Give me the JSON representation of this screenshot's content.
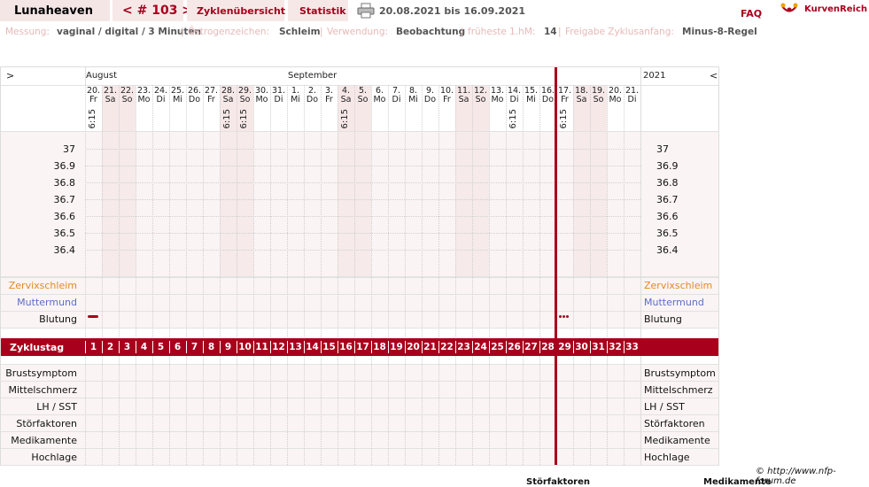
{
  "header": {
    "app_title": "Lunaheaven",
    "cycle_nav": "< # 103 >",
    "tabs": [
      {
        "label": "Zyklenübersicht"
      },
      {
        "label": "Statistik"
      }
    ],
    "date_range": "20.08.2021 bis 16.09.2021",
    "faq_label": "FAQ",
    "brand_label": "KurvenReich"
  },
  "info_bar": {
    "messung_label": "Messung:",
    "messung_value": "vaginal / digital / 3 Minuten",
    "oestrogen_label": "Östrogenzeichen:",
    "oestrogen_value": "Schleim",
    "verwendung_label": "Verwendung:",
    "verwendung_value": "Beobachtung",
    "hm_label": "früheste 1.hM:",
    "hm_value": "14",
    "freigabe_label": "Freigabe Zyklusanfang:",
    "freigabe_value": "Minus-8-Regel",
    "separator": "|"
  },
  "chart": {
    "left_arrow": ">",
    "right_arrow": "<",
    "months": [
      {
        "label": "August",
        "col": 0
      },
      {
        "label": "September",
        "col": 12
      }
    ],
    "year": "2021",
    "days": [
      {
        "d": "20.",
        "w": "Fr",
        "t": "6:15",
        "we": false
      },
      {
        "d": "21.",
        "w": "Sa",
        "t": "",
        "we": true
      },
      {
        "d": "22.",
        "w": "So",
        "t": "",
        "we": true
      },
      {
        "d": "23.",
        "w": "Mo",
        "t": "",
        "we": false
      },
      {
        "d": "24.",
        "w": "Di",
        "t": "",
        "we": false
      },
      {
        "d": "25.",
        "w": "Mi",
        "t": "",
        "we": false
      },
      {
        "d": "26.",
        "w": "Do",
        "t": "",
        "we": false
      },
      {
        "d": "27.",
        "w": "Fr",
        "t": "",
        "we": false
      },
      {
        "d": "28.",
        "w": "Sa",
        "t": "6:15",
        "we": true
      },
      {
        "d": "29.",
        "w": "So",
        "t": "6:15",
        "we": true
      },
      {
        "d": "30.",
        "w": "Mo",
        "t": "",
        "we": false
      },
      {
        "d": "31.",
        "w": "Di",
        "t": "",
        "we": false
      },
      {
        "d": "1.",
        "w": "Mi",
        "t": "",
        "we": false
      },
      {
        "d": "2.",
        "w": "Do",
        "t": "",
        "we": false
      },
      {
        "d": "3.",
        "w": "Fr",
        "t": "",
        "we": false
      },
      {
        "d": "4.",
        "w": "Sa",
        "t": "6:15",
        "we": true
      },
      {
        "d": "5.",
        "w": "So",
        "t": "",
        "we": true
      },
      {
        "d": "6.",
        "w": "Mo",
        "t": "",
        "we": false
      },
      {
        "d": "7.",
        "w": "Di",
        "t": "",
        "we": false
      },
      {
        "d": "8.",
        "w": "Mi",
        "t": "",
        "we": false
      },
      {
        "d": "9.",
        "w": "Do",
        "t": "",
        "we": false
      },
      {
        "d": "10.",
        "w": "Fr",
        "t": "",
        "we": false
      },
      {
        "d": "11.",
        "w": "Sa",
        "t": "",
        "we": true
      },
      {
        "d": "12.",
        "w": "So",
        "t": "",
        "we": true
      },
      {
        "d": "13.",
        "w": "Mo",
        "t": "",
        "we": false
      },
      {
        "d": "14.",
        "w": "Di",
        "t": "6:15",
        "we": false
      },
      {
        "d": "15.",
        "w": "Mi",
        "t": "",
        "we": false
      },
      {
        "d": "16.",
        "w": "Do",
        "t": "",
        "we": false
      },
      {
        "d": "17.",
        "w": "Fr",
        "t": "6:15",
        "we": false
      },
      {
        "d": "18.",
        "w": "Sa",
        "t": "",
        "we": true
      },
      {
        "d": "19.",
        "w": "So",
        "t": "",
        "we": true
      },
      {
        "d": "20.",
        "w": "Mo",
        "t": "",
        "we": false
      },
      {
        "d": "21.",
        "w": "Di",
        "t": "",
        "we": false
      }
    ],
    "temp_ticks": [
      "37",
      "36.9",
      "36.8",
      "36.7",
      "36.6",
      "36.5",
      "36.4"
    ],
    "rows_upper": [
      {
        "label": "Zervixschleim",
        "color": "#e08a1e"
      },
      {
        "label": "Muttermund",
        "color": "#5a6ec8"
      },
      {
        "label": "Blutung",
        "color": "#111111"
      }
    ],
    "zyklustag_label": "Zyklustag",
    "cycle_days": [
      "1",
      "2",
      "3",
      "4",
      "5",
      "6",
      "7",
      "8",
      "9",
      "10",
      "11",
      "12",
      "13",
      "14",
      "15",
      "16",
      "17",
      "18",
      "19",
      "20",
      "21",
      "22",
      "23",
      "24",
      "25",
      "26",
      "27",
      "28",
      "29",
      "30",
      "31",
      "32",
      "33"
    ],
    "rows_lower": [
      "Brustsymptom",
      "Mittelschmerz",
      "LH / SST",
      "Störfaktoren",
      "Medikamente",
      "Hochlage"
    ],
    "bleeding_days": [
      1,
      29
    ],
    "cycle_end_after_day": 28,
    "accent_color": "#a8001c",
    "weekend_color": "#f7e8e8"
  },
  "footer": {
    "credit": "© http://www.nfp-forum.de",
    "legend_a": "Störfaktoren",
    "legend_b": "Medikamente"
  }
}
